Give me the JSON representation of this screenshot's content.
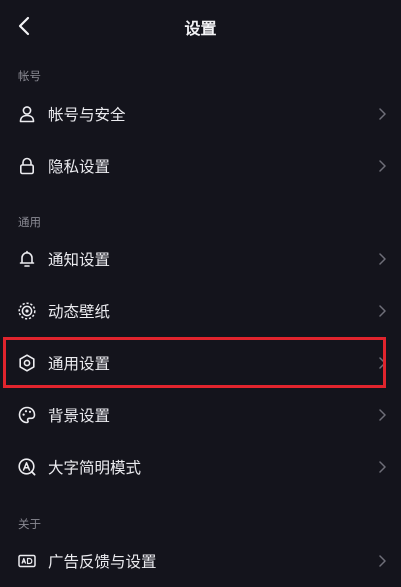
{
  "header": {
    "title": "设置",
    "back_icon": "chevron-left-icon"
  },
  "sections": [
    {
      "title": "帐号",
      "items": [
        {
          "label": "帐号与安全",
          "icon": "user-icon"
        },
        {
          "label": "隐私设置",
          "icon": "lock-icon"
        }
      ]
    },
    {
      "title": "通用",
      "items": [
        {
          "label": "通知设置",
          "icon": "bell-icon"
        },
        {
          "label": "动态壁纸",
          "icon": "live-wallpaper-icon"
        },
        {
          "label": "通用设置",
          "icon": "gear-icon",
          "highlighted": true
        },
        {
          "label": "背景设置",
          "icon": "palette-icon"
        },
        {
          "label": "大字简明模式",
          "icon": "font-size-icon"
        }
      ]
    },
    {
      "title": "关于",
      "items": [
        {
          "label": "广告反馈与设置",
          "icon": "ad-icon"
        }
      ]
    }
  ],
  "colors": {
    "background": "#14141c",
    "text": "#ececf0",
    "section_text": "#8a8a93",
    "highlight": "#e0242d"
  }
}
